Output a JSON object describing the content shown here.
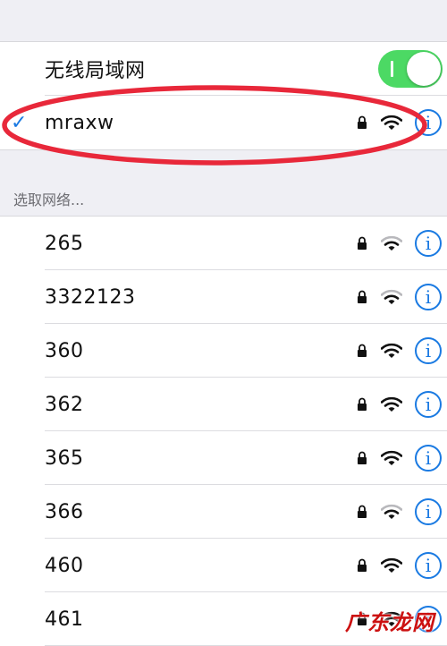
{
  "wifi_toggle": {
    "label": "无线局域网",
    "state": "on",
    "color": "#4cd964"
  },
  "connected_network": {
    "name": "mraxw",
    "checkmark": "✓",
    "secured": true,
    "signal": "full"
  },
  "section_header": "选取网络...",
  "networks": [
    {
      "name": "265",
      "secured": true,
      "signal": "weak"
    },
    {
      "name": "3322123",
      "secured": true,
      "signal": "weak"
    },
    {
      "name": "360",
      "secured": true,
      "signal": "full"
    },
    {
      "name": "362",
      "secured": true,
      "signal": "full"
    },
    {
      "name": "365",
      "secured": true,
      "signal": "full"
    },
    {
      "name": "366",
      "secured": true,
      "signal": "weak"
    },
    {
      "name": "460",
      "secured": true,
      "signal": "full"
    },
    {
      "name": "461",
      "secured": true,
      "signal": "full"
    }
  ],
  "info_glyph": "i",
  "accent_color": "#1a7ae2",
  "annotation_color": "#e8283a",
  "watermark": "广东龙网"
}
